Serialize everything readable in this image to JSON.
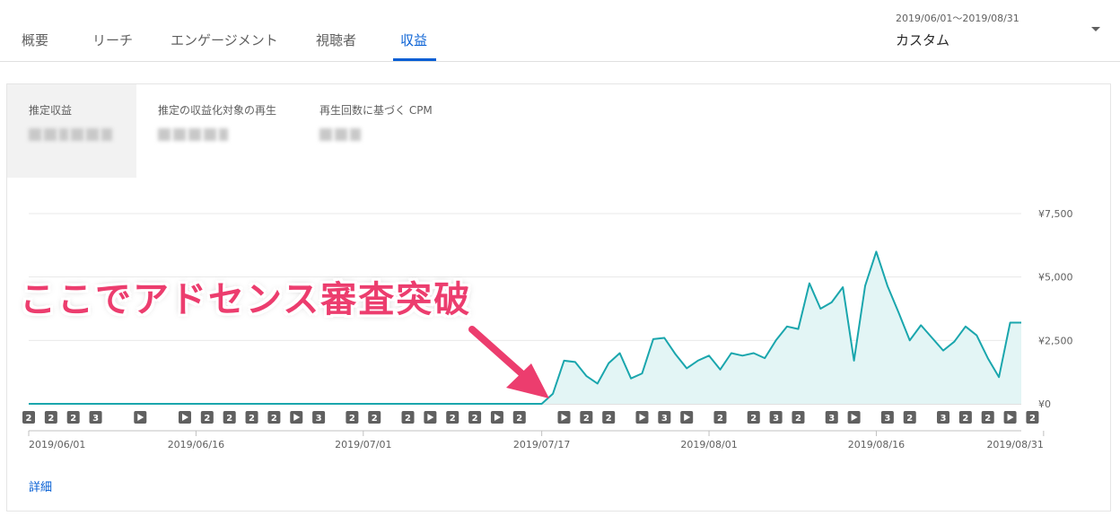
{
  "tabs": [
    {
      "label": "概要"
    },
    {
      "label": "リーチ"
    },
    {
      "label": "エンゲージメント"
    },
    {
      "label": "視聴者"
    },
    {
      "label": "収益"
    }
  ],
  "active_tab": 4,
  "date": {
    "range": "2019/06/01〜2019/08/31",
    "mode": "カスタム"
  },
  "metrics": [
    {
      "label": "推定収益"
    },
    {
      "label": "推定の収益化対象の再生"
    },
    {
      "label": "再生回数に基づく CPM"
    }
  ],
  "detail_link": "詳細",
  "annotation": "ここでアドセンス審査突破",
  "colors": {
    "accent": "#065fd4",
    "line": "#1aa6ad",
    "fill": "#e3f5f5",
    "annotation": "#ec3d6e",
    "marker": "#606060"
  },
  "chart_data": {
    "type": "area",
    "x_start": "2019/06/01",
    "x_end": "2019/08/31",
    "y_unit": "¥",
    "ylim": [
      0,
      7500
    ],
    "yticks": [
      "¥0",
      "¥2,500",
      "¥5,000",
      "¥7,500"
    ],
    "yticks_values": [
      0,
      2500,
      5000,
      7500
    ],
    "xtick_labels": [
      "2019/06/01",
      "2019/06/16",
      "2019/07/01",
      "2019/07/17",
      "2019/08/01",
      "2019/08/16",
      "2019/08/31"
    ],
    "xtick_days": [
      0,
      15,
      30,
      46,
      61,
      76,
      91
    ],
    "values": [
      0,
      0,
      0,
      0,
      0,
      0,
      0,
      0,
      0,
      0,
      0,
      0,
      0,
      0,
      0,
      0,
      0,
      0,
      0,
      0,
      0,
      0,
      0,
      0,
      0,
      0,
      0,
      0,
      0,
      0,
      0,
      0,
      0,
      0,
      0,
      0,
      0,
      0,
      0,
      0,
      0,
      0,
      0,
      0,
      0,
      0,
      0,
      400,
      1700,
      1650,
      1100,
      800,
      1600,
      2000,
      1000,
      1200,
      2550,
      2600,
      1950,
      1400,
      1700,
      1900,
      1350,
      2000,
      1900,
      2000,
      1800,
      2500,
      3050,
      2950,
      4750,
      3750,
      4000,
      4600,
      1700,
      4650,
      6000,
      4650,
      3600,
      2500,
      3100,
      2600,
      2100,
      2450,
      3050,
      2700,
      1800,
      1050,
      3200,
      3200
    ],
    "markers": [
      {
        "label": "2",
        "day": 0
      },
      {
        "label": "2",
        "day": 2
      },
      {
        "label": "2",
        "day": 4
      },
      {
        "label": "3",
        "day": 6
      },
      {
        "label": "",
        "day": 10
      },
      {
        "label": "",
        "day": 14
      },
      {
        "label": "2",
        "day": 16
      },
      {
        "label": "2",
        "day": 18
      },
      {
        "label": "2",
        "day": 20
      },
      {
        "label": "2",
        "day": 22
      },
      {
        "label": "",
        "day": 24
      },
      {
        "label": "3",
        "day": 26
      },
      {
        "label": "2",
        "day": 29
      },
      {
        "label": "2",
        "day": 31
      },
      {
        "label": "2",
        "day": 34
      },
      {
        "label": "",
        "day": 36
      },
      {
        "label": "2",
        "day": 38
      },
      {
        "label": "2",
        "day": 40
      },
      {
        "label": "",
        "day": 42
      },
      {
        "label": "2",
        "day": 44
      },
      {
        "label": "",
        "day": 48
      },
      {
        "label": "2",
        "day": 50
      },
      {
        "label": "2",
        "day": 52
      },
      {
        "label": "",
        "day": 55
      },
      {
        "label": "3",
        "day": 57
      },
      {
        "label": "",
        "day": 59
      },
      {
        "label": "2",
        "day": 62
      },
      {
        "label": "2",
        "day": 65
      },
      {
        "label": "3",
        "day": 67
      },
      {
        "label": "2",
        "day": 69
      },
      {
        "label": "3",
        "day": 72
      },
      {
        "label": "",
        "day": 74
      },
      {
        "label": "3",
        "day": 77
      },
      {
        "label": "2",
        "day": 79
      },
      {
        "label": "3",
        "day": 82
      },
      {
        "label": "2",
        "day": 84
      },
      {
        "label": "2",
        "day": 86
      },
      {
        "label": "",
        "day": 88
      },
      {
        "label": "2",
        "day": 90
      }
    ]
  }
}
